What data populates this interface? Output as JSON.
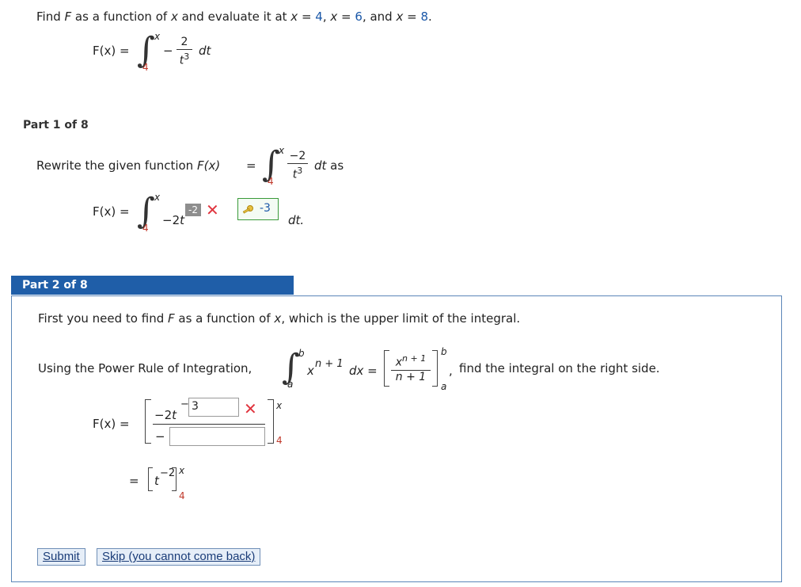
{
  "question": {
    "prompt_prefix": "Find ",
    "prompt_F": "F",
    "prompt_mid": " as a function of ",
    "prompt_x": "x",
    "prompt_eval": " and evaluate it at ",
    "x1": "x",
    "eq1": " = ",
    "v1": "4",
    "c1": ",  ",
    "x2": "x",
    "eq2": " = ",
    "v2": "6",
    "c2": ", and ",
    "x3": "x",
    "eq3": " = ",
    "v3": "8",
    "period": ".",
    "fx_label": "F(x)  =",
    "upper": "x",
    "lower": "4",
    "minus": "−",
    "num": "2",
    "den": "t",
    "den_exp": "3",
    "dt": "dt"
  },
  "part1": {
    "label": "Part 1 of 8",
    "rewrite_text": "Rewrite the given function ",
    "fx_inline": "F(x)",
    "eq": "=",
    "upper": "x",
    "lower": "4",
    "num": "−2",
    "den": "t",
    "den_exp": "3",
    "dt_as": "dt  as",
    "fx_label": "F(x)  =",
    "answer_upper": "x",
    "answer_lower": "4",
    "coef": "−2t",
    "wrong_exp": "-2",
    "correct_exp": "-3",
    "dt_end": "dt."
  },
  "part2": {
    "label": "Part 2 of 8",
    "intro_prefix": "First you need to find ",
    "intro_F": "F",
    "intro_mid": " as a function of ",
    "intro_x": "x",
    "intro_suffix": ", which is the upper limit of the integral.",
    "rule_text": "Using the Power Rule of Integration,",
    "rule_upper": "b",
    "rule_lower": "a",
    "rule_integrand": "x",
    "rule_exp": "n + 1",
    "rule_dx": "dx  =",
    "rule_frac_num": "x",
    "rule_frac_num_exp": "n + 1",
    "rule_frac_den": "n + 1",
    "rule_b": "b",
    "rule_a": "a",
    "rule_comma": ",",
    "rule_suffix": "find the integral on the right side.",
    "fx_label": "F(x)  =",
    "coef": "−2t",
    "exp_minus": "−",
    "exp_value": "3",
    "den_minus": "−",
    "den_value": "",
    "bracket_upper": "x",
    "bracket_lower": "4",
    "eq2": "=",
    "simplified": "t",
    "simplified_exp": "−2",
    "simp_upper": "x",
    "simp_lower": "4"
  },
  "buttons": {
    "submit": "Submit",
    "skip": "Skip (you cannot come back)"
  },
  "colors": {
    "accent": "#1f5ea8",
    "error": "#e0353f",
    "value_blue": "#1a57a8",
    "correct_green": "#3a9a3a"
  }
}
